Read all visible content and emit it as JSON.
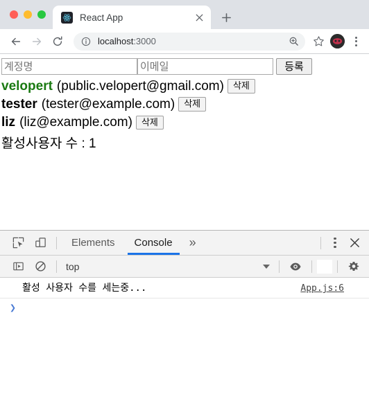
{
  "window": {
    "traffic_lights": [
      "close",
      "minimize",
      "zoom"
    ],
    "colors": {
      "red": "#ff5f57",
      "amber": "#febc2e",
      "green": "#28c840"
    }
  },
  "browser": {
    "tab": {
      "title": "React App",
      "favicon": "react-logo",
      "close_label": "×"
    },
    "new_tab_label": "+",
    "nav": {
      "back_label": "←",
      "forward_label": "→",
      "reload_label": "⟳"
    },
    "omnibox": {
      "info_label": "ⓘ",
      "host": "localhost",
      "port": ":3000",
      "zoom_icon": "zoom-in-icon",
      "bookmark_icon": "star-icon"
    },
    "profile_avatar": "user-avatar",
    "menu_label": "⋮"
  },
  "page": {
    "form": {
      "username_placeholder": "계정명",
      "username_value": "",
      "email_placeholder": "이메일",
      "email_value": "",
      "submit_label": "등록"
    },
    "users": [
      {
        "username": "velopert",
        "email": "(public.velopert@gmail.com)",
        "active": true,
        "delete_label": "삭제"
      },
      {
        "username": "tester",
        "email": "(tester@example.com)",
        "active": false,
        "delete_label": "삭제"
      },
      {
        "username": "liz",
        "email": "(liz@example.com)",
        "active": false,
        "delete_label": "삭제"
      }
    ],
    "active_count_text": "활성사용자 수 : 1",
    "active_color": "#1a7a12"
  },
  "devtools": {
    "inspect_icon": "inspect-element-icon",
    "device_icon": "device-toolbar-icon",
    "tabs": [
      {
        "label": "Elements",
        "active": false
      },
      {
        "label": "Console",
        "active": true
      }
    ],
    "more_tabs_label": "»",
    "settings_menu_label": "⋮",
    "close_label": "✕",
    "filterbar": {
      "sidebar_icon": "console-sidebar-icon",
      "clear_icon": "clear-console-icon",
      "context": "top",
      "eye_icon": "eye-icon",
      "filter_value": "",
      "filter_placeholder": "",
      "settings_icon": "gear-icon"
    },
    "console": {
      "messages": [
        {
          "text": "활성 사용자 수를 세는중...",
          "source": "App.js:6"
        }
      ],
      "prompt_caret": "❯",
      "prompt_value": ""
    },
    "accent_color": "#1a73e8"
  }
}
